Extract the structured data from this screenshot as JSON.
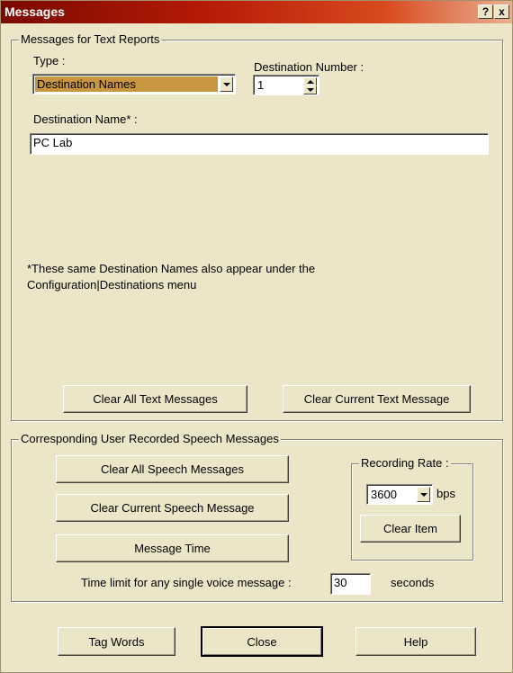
{
  "window": {
    "title": "Messages",
    "help_glyph": "?",
    "close_glyph": "x"
  },
  "text_reports": {
    "legend": "Messages for Text Reports",
    "type_label": "Type :",
    "type_value": "Destination Names",
    "dest_number_label": "Destination Number :",
    "dest_number_value": "1",
    "dest_name_label": "Destination Name* :",
    "dest_name_value": "PC Lab",
    "note_line1": "*These same Destination Names also appear under the",
    "note_line2": "Configuration|Destinations menu",
    "clear_all_text_label": "Clear All Text Messages",
    "clear_current_text_label": "Clear Current Text Message"
  },
  "speech": {
    "legend": "Corresponding User Recorded Speech Messages",
    "clear_all_speech_label": "Clear All Speech Messages",
    "clear_current_speech_label": "Clear Current Speech Message",
    "message_time_label": "Message Time",
    "recording_rate_legend": "Recording Rate :",
    "rate_value": "3600",
    "rate_unit": "bps",
    "clear_item_label": "Clear Item",
    "time_limit_label": "Time limit for any single voice message :",
    "time_limit_value": "30",
    "time_limit_unit": "seconds"
  },
  "footer": {
    "tag_words_label": "Tag Words",
    "close_label": "Close",
    "help_label": "Help"
  },
  "colors": {
    "titlebar_start": "#7a0a00",
    "titlebar_end": "#e8b090",
    "dialog_bg": "#ede5c8",
    "combo_selection": "#c7963e"
  }
}
